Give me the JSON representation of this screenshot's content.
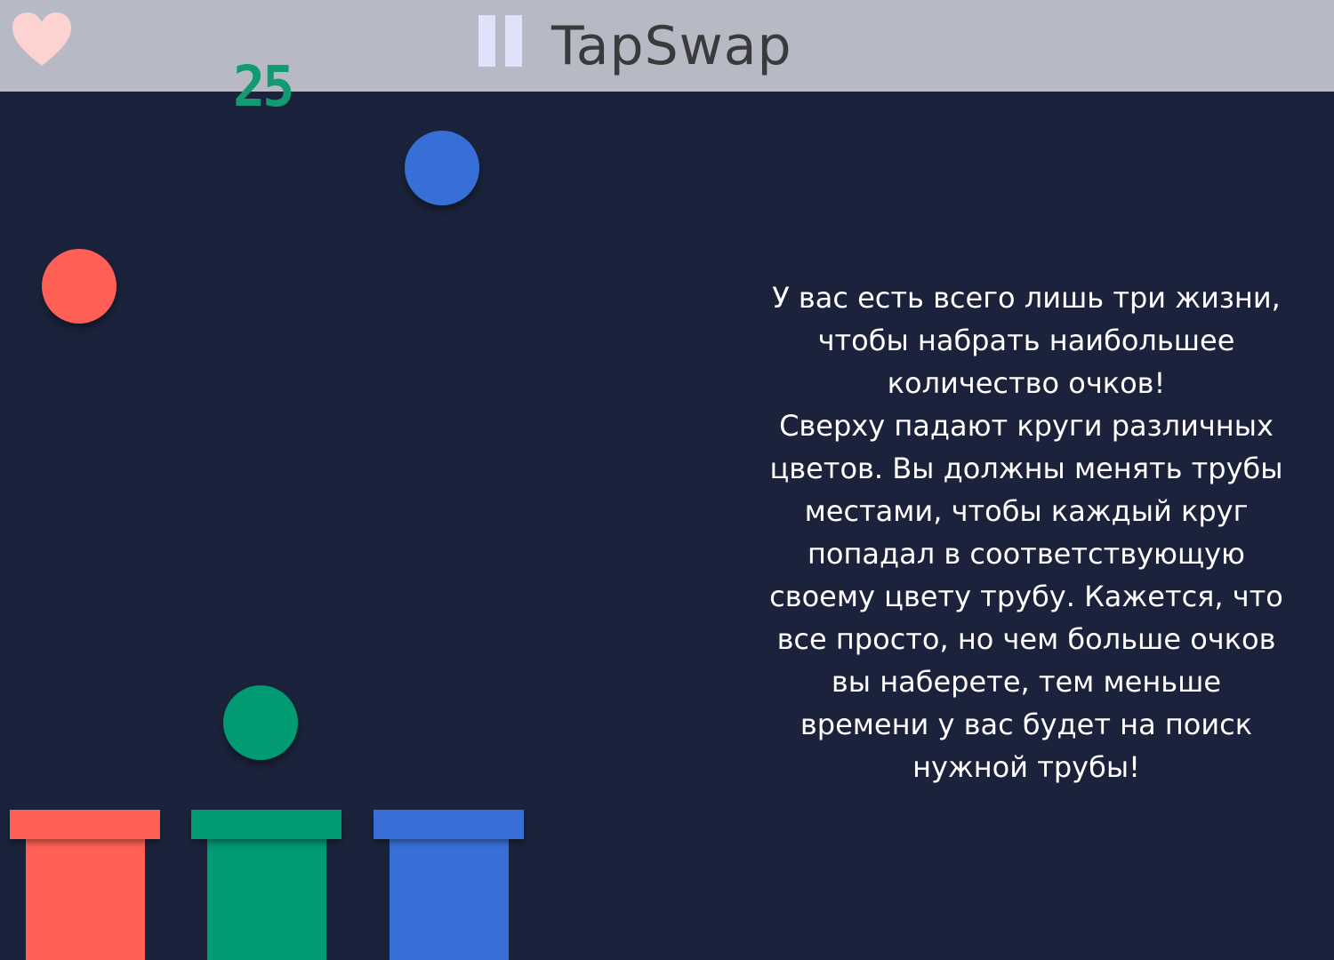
{
  "header": {
    "title": "TapSwap",
    "lives_icon": "heart-icon",
    "pause_icon": "pause-icon"
  },
  "game": {
    "score": "25",
    "falling_balls": [
      {
        "color_name": "blue",
        "color": "#376fd7"
      },
      {
        "color_name": "red",
        "color": "#ff5f55"
      },
      {
        "color_name": "green",
        "color": "#009a73"
      }
    ],
    "pipes": [
      {
        "color_name": "red",
        "color": "#ff5f55"
      },
      {
        "color_name": "green",
        "color": "#009a73"
      },
      {
        "color_name": "blue",
        "color": "#376fd7"
      }
    ]
  },
  "instructions": {
    "text": "У вас есть всего лишь три жизни,\nчтобы набрать наибольшее\nколичество очков!\nСверху падают круги различных\nцветов. Вы должны менять трубы\nместами, чтобы каждый круг\nпопадал в соответствующую\nсвоему цвету трубу. Кажется, что\nвсе просто, но чем больше очков\nвы наберете, тем меньше\nвремени у вас будет на поиск\nнужной трубы!"
  },
  "colors": {
    "background": "#1a233b",
    "topbar": "#b7bac4",
    "heart": "#ffd4d2",
    "pause": "#dfe2fb",
    "score": "#139a73",
    "title": "#3a3a3c"
  }
}
